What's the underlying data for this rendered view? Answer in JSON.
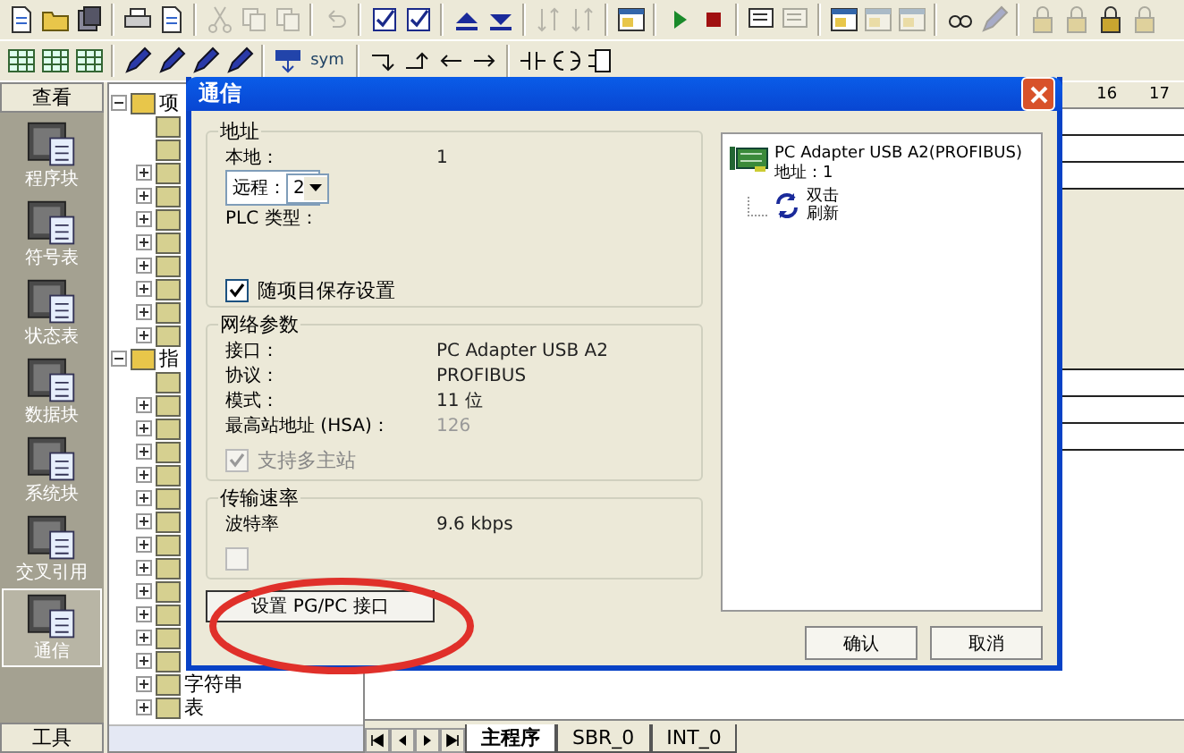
{
  "toolbar_rows": [
    [
      {
        "kind": "doc",
        "disabled": false
      },
      {
        "kind": "folder",
        "disabled": false
      },
      {
        "kind": "save",
        "disabled": false
      },
      {
        "kind": "sep"
      },
      {
        "kind": "print",
        "disabled": false
      },
      {
        "kind": "doc",
        "disabled": false
      },
      {
        "kind": "sep"
      },
      {
        "kind": "cut",
        "disabled": true
      },
      {
        "kind": "copy",
        "disabled": true
      },
      {
        "kind": "copy",
        "disabled": true
      },
      {
        "kind": "sep"
      },
      {
        "kind": "undo",
        "disabled": true
      },
      {
        "kind": "sep"
      },
      {
        "kind": "check",
        "disabled": false
      },
      {
        "kind": "check",
        "disabled": false
      },
      {
        "kind": "sep"
      },
      {
        "kind": "up",
        "disabled": false
      },
      {
        "kind": "down",
        "disabled": false
      },
      {
        "kind": "sep"
      },
      {
        "kind": "sort",
        "disabled": true
      },
      {
        "kind": "sort",
        "disabled": true
      },
      {
        "kind": "sep"
      },
      {
        "kind": "window",
        "disabled": false
      },
      {
        "kind": "sep"
      },
      {
        "kind": "play",
        "disabled": false
      },
      {
        "kind": "stop",
        "disabled": false
      },
      {
        "kind": "sep"
      },
      {
        "kind": "monitor",
        "disabled": false
      },
      {
        "kind": "monitor",
        "disabled": true
      },
      {
        "kind": "sep"
      },
      {
        "kind": "window",
        "disabled": false
      },
      {
        "kind": "window",
        "disabled": true
      },
      {
        "kind": "window",
        "disabled": true
      },
      {
        "kind": "sep"
      },
      {
        "kind": "glasses",
        "disabled": false
      },
      {
        "kind": "pen",
        "disabled": true
      },
      {
        "kind": "sep"
      },
      {
        "kind": "lock",
        "disabled": true
      },
      {
        "kind": "lock",
        "disabled": true
      },
      {
        "kind": "lock",
        "disabled": false
      },
      {
        "kind": "lock",
        "disabled": true
      }
    ],
    [
      {
        "kind": "grid",
        "disabled": false
      },
      {
        "kind": "grid",
        "disabled": false
      },
      {
        "kind": "grid",
        "disabled": false
      },
      {
        "kind": "sep"
      },
      {
        "kind": "pen",
        "disabled": false
      },
      {
        "kind": "pen",
        "disabled": false
      },
      {
        "kind": "pen",
        "disabled": false
      },
      {
        "kind": "pen",
        "disabled": false
      },
      {
        "kind": "sep"
      },
      {
        "kind": "download",
        "disabled": false
      },
      {
        "kind": "text",
        "label": "sym"
      },
      {
        "kind": "sep"
      },
      {
        "kind": "line-down",
        "disabled": false
      },
      {
        "kind": "line-up",
        "disabled": false
      },
      {
        "kind": "left",
        "disabled": false
      },
      {
        "kind": "right",
        "disabled": false
      },
      {
        "kind": "sep"
      },
      {
        "kind": "contact",
        "disabled": false
      },
      {
        "kind": "coil",
        "disabled": false
      },
      {
        "kind": "box",
        "disabled": false
      }
    ]
  ],
  "navbar": {
    "title": "查看",
    "items": [
      {
        "label": "程序块",
        "selected": false
      },
      {
        "label": "符号表",
        "selected": false
      },
      {
        "label": "状态表",
        "selected": false
      },
      {
        "label": "数据块",
        "selected": false
      },
      {
        "label": "系统块",
        "selected": false
      },
      {
        "label": "交叉引用",
        "selected": false
      },
      {
        "label": "通信",
        "selected": true
      }
    ],
    "footer": "工具"
  },
  "tree": [
    {
      "label": "项",
      "expanded": true,
      "children": [
        {
          "expandable": false
        },
        {
          "expandable": false
        },
        {
          "expandable": true
        },
        {
          "expandable": true
        },
        {
          "expandable": true
        },
        {
          "expandable": true
        },
        {
          "expandable": true
        },
        {
          "expandable": true
        },
        {
          "expandable": true
        },
        {
          "expandable": true
        }
      ]
    },
    {
      "label": "指",
      "expanded": true,
      "children": [
        {
          "expandable": false
        },
        {
          "expandable": true
        },
        {
          "expandable": true
        },
        {
          "expandable": true
        },
        {
          "expandable": true
        },
        {
          "expandable": true
        },
        {
          "expandable": true
        },
        {
          "expandable": true
        },
        {
          "expandable": true
        },
        {
          "expandable": true
        },
        {
          "expandable": true
        },
        {
          "expandable": true
        },
        {
          "expandable": true
        },
        {
          "label": "字符串",
          "expandable": true
        },
        {
          "label": "表",
          "expandable": true
        }
      ]
    }
  ],
  "editor": {
    "ruler": [
      "16",
      "17"
    ],
    "tabs": [
      {
        "label": "主程序",
        "selected": true
      },
      {
        "label": "SBR_0",
        "selected": false
      },
      {
        "label": "INT_0",
        "selected": false
      }
    ]
  },
  "dialog": {
    "title": "通信",
    "groups": [
      {
        "title": "地址",
        "rows": [
          {
            "kind": "field",
            "label": "本地：",
            "value": "1"
          },
          {
            "kind": "select",
            "label": "远程：",
            "value": "2"
          },
          {
            "kind": "field",
            "label": "PLC 类型："
          },
          {
            "kind": "checkbox",
            "label": "随项目保存设置",
            "checked": true,
            "disabled": false
          }
        ]
      },
      {
        "title": "网络参数",
        "rows": [
          {
            "kind": "field",
            "label": "接口：",
            "value": "PC Adapter USB A2"
          },
          {
            "kind": "field",
            "label": "协议：",
            "value": "PROFIBUS"
          },
          {
            "kind": "field",
            "label": "模式：",
            "value": "11 位"
          },
          {
            "kind": "field",
            "label": "最高站地址 (HSA)：",
            "value": "126",
            "disabled": true
          },
          {
            "kind": "checkbox",
            "label": "支持多主站",
            "checked": true,
            "disabled": true
          }
        ]
      },
      {
        "title": "传输速率",
        "rows": [
          {
            "kind": "field",
            "label": "波特率",
            "value": "9.6 kbps"
          },
          {
            "kind": "checkbox",
            "checked": false,
            "disabled": true
          }
        ]
      }
    ],
    "setup_button": "设置 PG/PC 接口",
    "device": {
      "name": "PC Adapter USB A2(PROFIBUS)",
      "address": "地址：1",
      "refresh": [
        "双击",
        "刷新"
      ]
    },
    "buttons": [
      "确认",
      "取消"
    ]
  }
}
